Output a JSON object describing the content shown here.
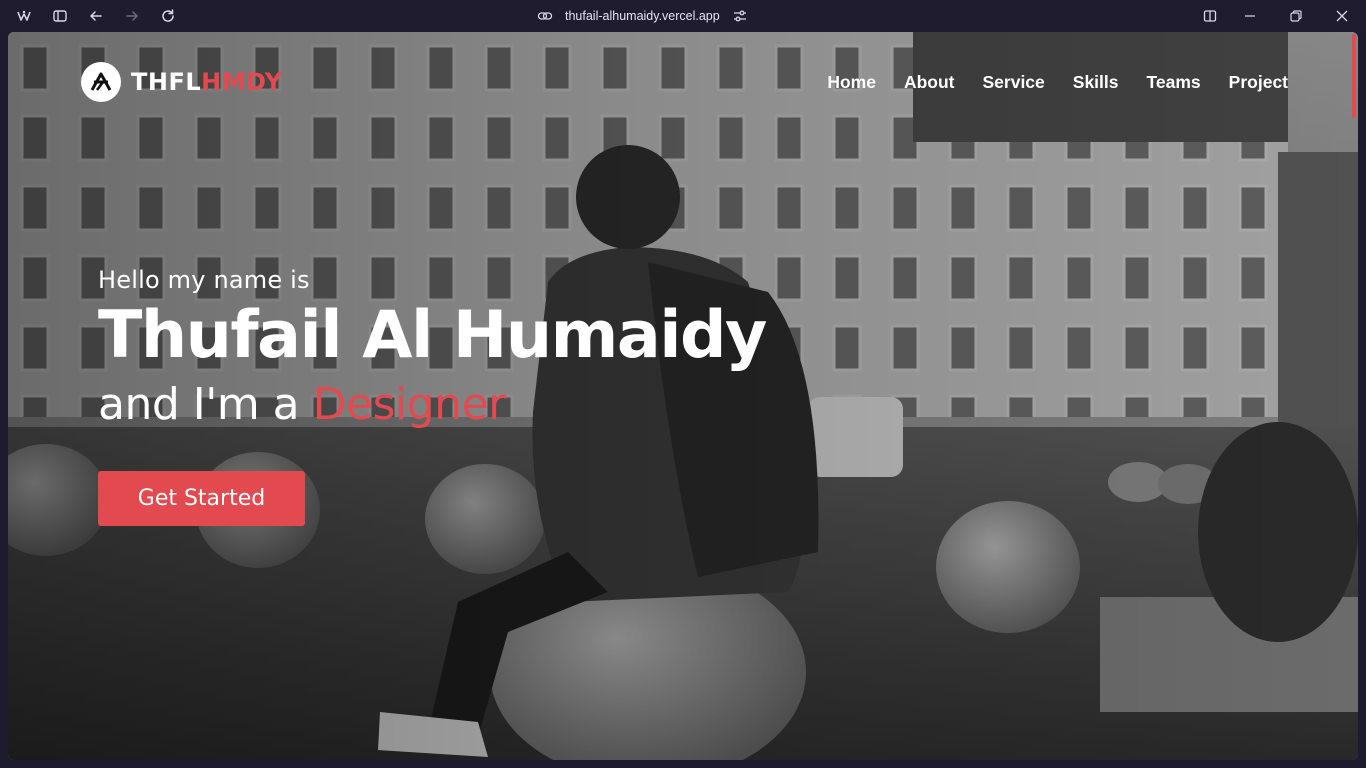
{
  "browser": {
    "url": "thufail-alhumaidy.vercel.app",
    "icons": [
      "app-logo-icon",
      "sidebar-icon",
      "back-icon",
      "forward-icon",
      "reload-icon",
      "link-icon",
      "site-settings-icon",
      "split-view-icon",
      "minimize-icon",
      "restore-icon",
      "close-icon"
    ]
  },
  "site": {
    "logo": {
      "part1": "THFL",
      "part2": "HMDY"
    },
    "nav": [
      "Home",
      "About",
      "Service",
      "Skills",
      "Teams",
      "Project"
    ],
    "hero": {
      "greeting": "Hello my name is",
      "name": "Thufail Al Humaidy",
      "role_prefix": "and I'm a",
      "role": "Designer",
      "cta": "Get Started"
    },
    "accent_color": "#e24a4f"
  }
}
